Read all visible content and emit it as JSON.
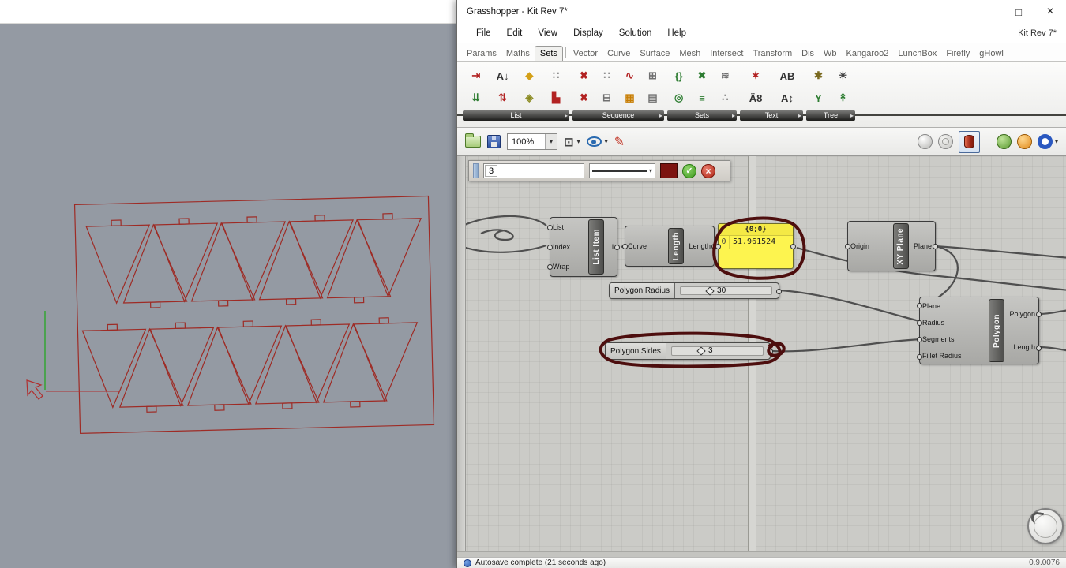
{
  "colors": {
    "annotation_red": "#4d0e0e",
    "panel_yellow": "#fdf44f",
    "drawing_red": "#9e2b25",
    "axis_green": "#3aa53a",
    "wire_gray": "#4f4f4f",
    "swatch_maroon": "#7c1410"
  },
  "icons": {
    "dropdown": "▾",
    "check": "✓",
    "close_x": "×",
    "minimize": "–",
    "maximize": "□",
    "group_arrow": "▸",
    "pen": "✎"
  },
  "gh": {
    "title": "Grasshopper - Kit Rev 7*",
    "doc_label": "Kit Rev 7*",
    "menus": [
      "File",
      "Edit",
      "View",
      "Display",
      "Solution",
      "Help"
    ],
    "tabs": [
      "Params",
      "Maths",
      "Sets",
      "Vector",
      "Curve",
      "Surface",
      "Mesh",
      "Intersect",
      "Transform",
      "Dis",
      "Wb",
      "Kangaroo2",
      "LunchBox",
      "Firefly",
      "gHowl"
    ],
    "active_tab": "Sets",
    "ribbon": {
      "groups": [
        {
          "label": "List",
          "icons": [
            {
              "name": "insert-items-icon",
              "glyph": "⇥"
            },
            {
              "name": "list-length-icon",
              "glyph": "A↓"
            },
            {
              "name": "item-index-icon",
              "glyph": "◆"
            },
            {
              "name": "partition-list-icon",
              "glyph": "∷"
            },
            {
              "name": "pick-choose-icon",
              "glyph": "⇊"
            },
            {
              "name": "sort-list-icon",
              "glyph": "⇅"
            },
            {
              "name": "reverse-list-icon",
              "glyph": "◈"
            },
            {
              "name": "weave-icon",
              "glyph": "▙"
            }
          ]
        },
        {
          "label": "Sequence",
          "icons": [
            {
              "name": "cull-pattern-icon",
              "glyph": "✖"
            },
            {
              "name": "random-icon",
              "glyph": "∷"
            },
            {
              "name": "jitter-icon",
              "glyph": "∿"
            },
            {
              "name": "range-icon",
              "glyph": "⊞"
            },
            {
              "name": "cull-index-icon",
              "glyph": "✖"
            },
            {
              "name": "series-icon",
              "glyph": "⊟"
            },
            {
              "name": "repeat-data-icon",
              "glyph": "▦"
            },
            {
              "name": "stack-data-icon",
              "glyph": "▤"
            }
          ]
        },
        {
          "label": "Sets",
          "icons": [
            {
              "name": "create-set-icon",
              "glyph": "{}"
            },
            {
              "name": "set-difference-icon",
              "glyph": "✖"
            },
            {
              "name": "set-union-icon",
              "glyph": "≋"
            },
            {
              "name": "member-index-icon",
              "glyph": "◎"
            },
            {
              "name": "set-intersection-icon",
              "glyph": "≡"
            },
            {
              "name": "delete-consecutive-icon",
              "glyph": "∴"
            }
          ]
        },
        {
          "label": "Text",
          "icons": [
            {
              "name": "text-fragment-icon",
              "glyph": "✶"
            },
            {
              "name": "concatenate-icon",
              "glyph": "AB"
            },
            {
              "name": "characters-icon",
              "glyph": "Ä8"
            },
            {
              "name": "sort-text-icon",
              "glyph": "A↕"
            }
          ]
        },
        {
          "label": "Tree",
          "icons": [
            {
              "name": "explode-tree-icon",
              "glyph": "✱"
            },
            {
              "name": "flatten-tree-icon",
              "glyph": "✳"
            },
            {
              "name": "graft-tree-icon",
              "glyph": "Y"
            },
            {
              "name": "simplify-tree-icon",
              "glyph": "↟"
            }
          ]
        }
      ]
    },
    "toolbar": {
      "zoom": "100%"
    },
    "sketch": {
      "value": "3"
    },
    "canvas": {
      "components": {
        "list_item": {
          "title": "List Item",
          "inputs": [
            "List",
            "Index",
            "Wrap"
          ],
          "outputs": [
            "i"
          ]
        },
        "length": {
          "title": "Length",
          "inputs": [
            "Curve"
          ],
          "outputs": [
            "Length"
          ]
        },
        "panel": {
          "header": "{0;0}",
          "index": "0",
          "value": "51.961524"
        },
        "xy_plane": {
          "title": "XY Plane",
          "inputs": [
            "Origin"
          ],
          "outputs": [
            "Plane"
          ]
        },
        "polygon": {
          "title": "Polygon",
          "inputs": [
            "Plane",
            "Radius",
            "Segments",
            "Fillet Radius"
          ],
          "outputs": [
            "Polygon",
            "Length"
          ]
        },
        "slider_radius": {
          "label": "Polygon Radius",
          "value": "30"
        },
        "slider_sides": {
          "label": "Polygon Sides",
          "value": "3"
        }
      }
    },
    "status": {
      "message": "Autosave complete (21 seconds ago)",
      "version": "0.9.0076"
    }
  }
}
